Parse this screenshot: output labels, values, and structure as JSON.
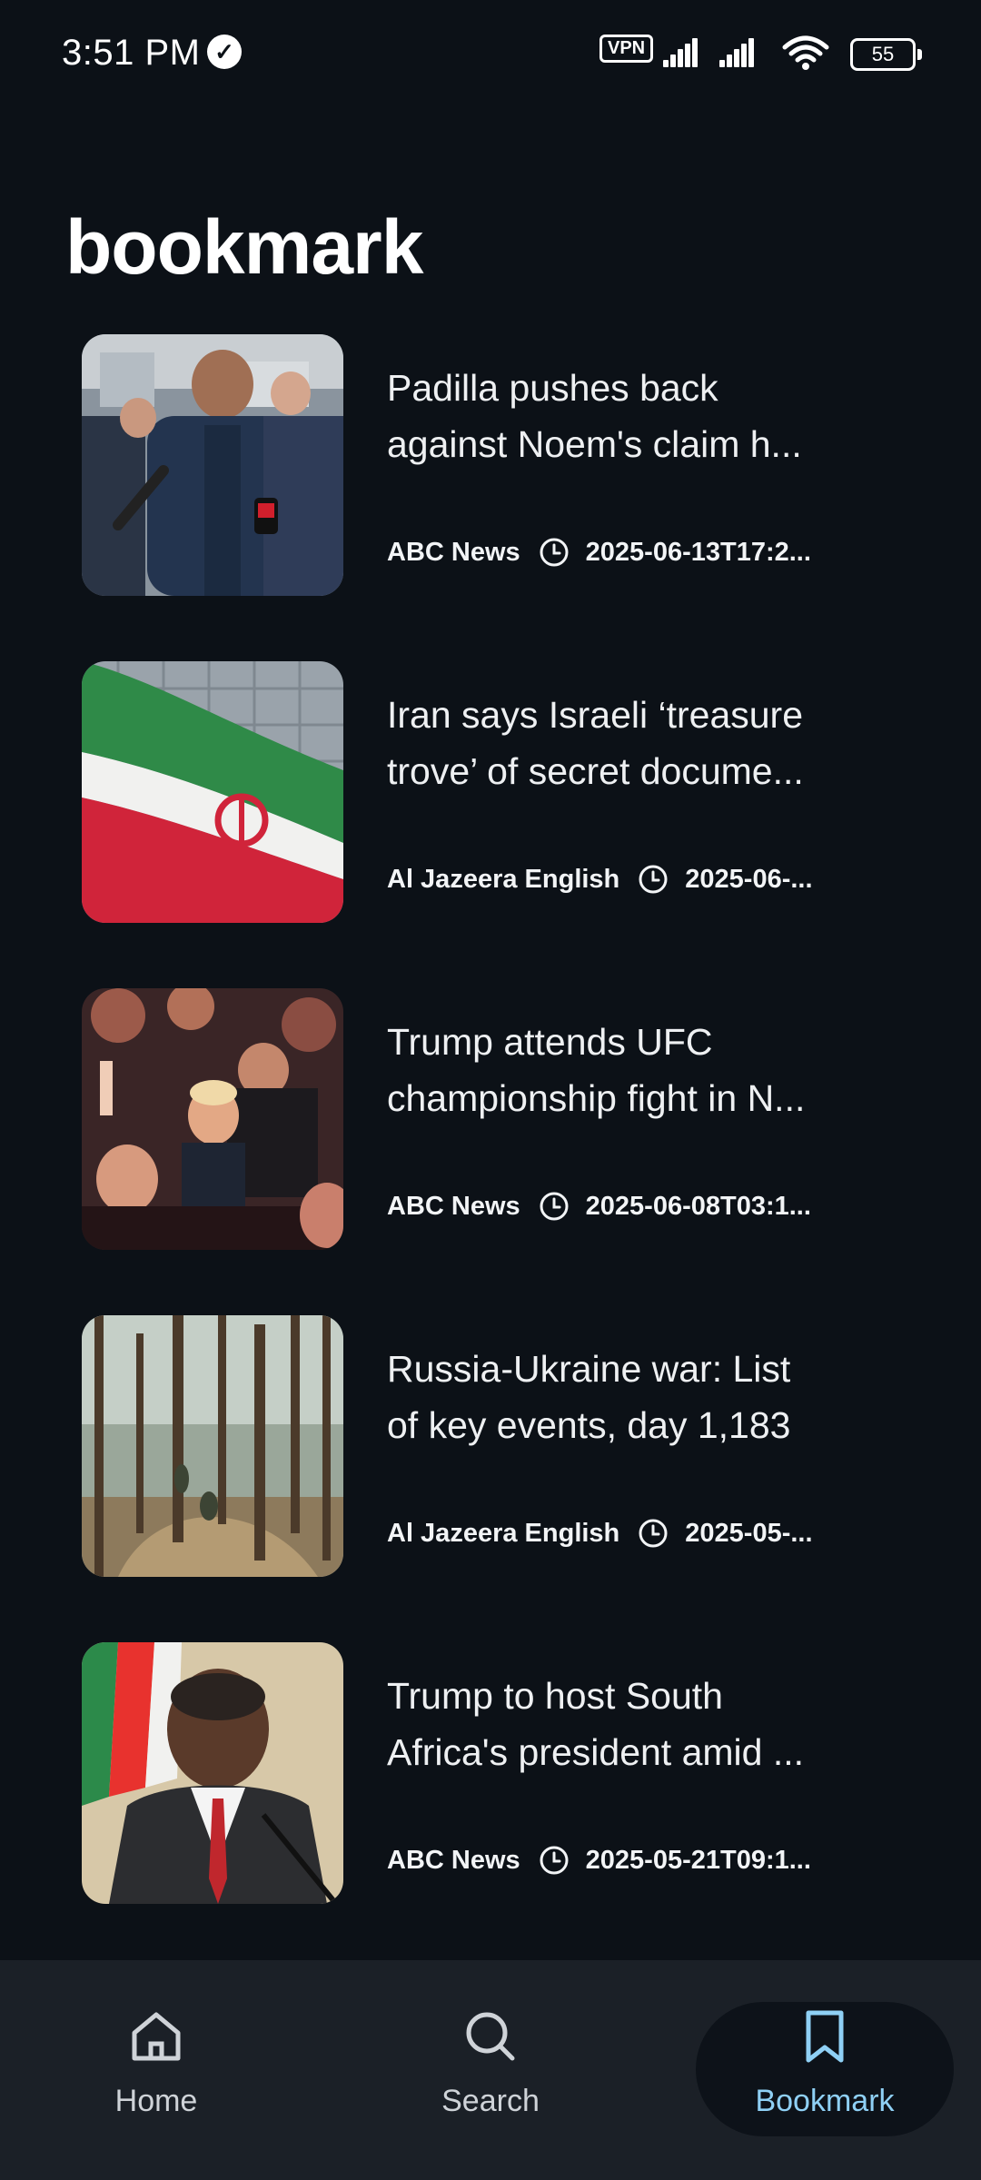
{
  "status_bar": {
    "time": "3:51 PM",
    "vpn": "VPN",
    "battery": "55"
  },
  "page": {
    "title": "bookmark"
  },
  "articles": [
    {
      "title_line1": "Padilla pushes back",
      "title_line2": "against Noem's claim h...",
      "source": "ABC News",
      "date": "2025-06-13T17:2..."
    },
    {
      "title_line1": "Iran says Israeli ‘treasure",
      "title_line2": "trove’ of secret docume...",
      "source": "Al Jazeera English",
      "date": "2025-06-..."
    },
    {
      "title_line1": "Trump attends UFC",
      "title_line2": "championship fight in N...",
      "source": "ABC News",
      "date": "2025-06-08T03:1..."
    },
    {
      "title_line1": "Russia-Ukraine war: List",
      "title_line2": "of key events, day 1,183",
      "source": "Al Jazeera English",
      "date": "2025-05-..."
    },
    {
      "title_line1": "Trump to host South",
      "title_line2": "Africa's president amid ...",
      "source": "ABC News",
      "date": "2025-05-21T09:1..."
    }
  ],
  "bottom_nav": [
    {
      "label": "Home",
      "icon": "home-icon"
    },
    {
      "label": "Search",
      "icon": "search-icon"
    },
    {
      "label": "Bookmark",
      "icon": "bookmark-icon",
      "active": true
    }
  ],
  "colors": {
    "background": "#0c1117",
    "nav_bar": "#1b2027",
    "accent": "#8fd0f5"
  }
}
